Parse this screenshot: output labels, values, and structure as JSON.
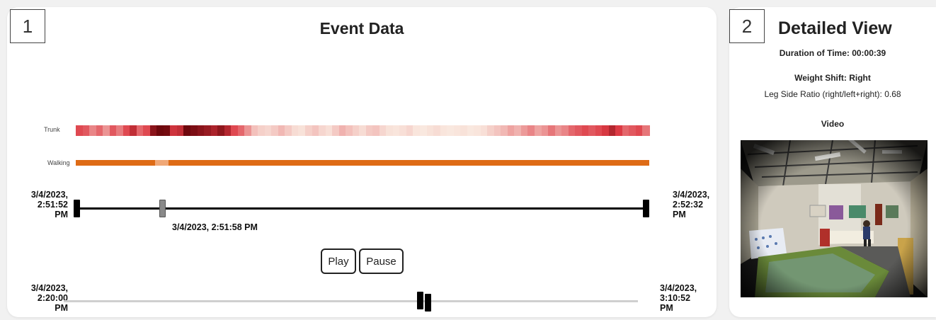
{
  "event_panel": {
    "number": "1",
    "title": "Event Data",
    "rows": [
      {
        "label": "Trunk"
      },
      {
        "label": "Walking"
      }
    ],
    "timeline": {
      "start_label_lines": [
        "3/4/2023,",
        "2:51:52",
        "PM"
      ],
      "end_label_lines": [
        "3/4/2023,",
        "2:52:32",
        "PM"
      ],
      "current_label": "3/4/2023, 2:51:58 PM",
      "position_fraction": 0.15
    },
    "controls": {
      "play_label": "Play",
      "pause_label": "Pause"
    },
    "overview": {
      "start_label_lines": [
        "3/4/2023,",
        "2:20:00",
        "PM"
      ],
      "end_label_lines": [
        "3/4/2023,",
        "3:10:52",
        "PM"
      ],
      "window_fraction": [
        0.62,
        0.634
      ]
    },
    "colors": {
      "walking": "#de6b16",
      "walking_highlight": "#f0a877",
      "track": "#000000",
      "overview_track": "#cfcfcf",
      "handle_gray": "#8a8a8a"
    },
    "trunk_intensity": [
      0.55,
      0.5,
      0.35,
      0.45,
      0.3,
      0.5,
      0.38,
      0.55,
      0.7,
      0.45,
      0.55,
      0.9,
      1.0,
      0.98,
      0.65,
      0.7,
      1.0,
      0.95,
      0.9,
      0.85,
      0.78,
      0.88,
      0.75,
      0.55,
      0.45,
      0.3,
      0.15,
      0.1,
      0.08,
      0.12,
      0.18,
      0.12,
      0.06,
      0.04,
      0.1,
      0.14,
      0.08,
      0.05,
      0.12,
      0.2,
      0.15,
      0.1,
      0.06,
      0.12,
      0.14,
      0.08,
      0.04,
      0.03,
      0.05,
      0.08,
      0.03,
      0.02,
      0.04,
      0.06,
      0.03,
      0.02,
      0.03,
      0.04,
      0.02,
      0.03,
      0.05,
      0.1,
      0.14,
      0.18,
      0.25,
      0.2,
      0.28,
      0.35,
      0.25,
      0.3,
      0.4,
      0.3,
      0.35,
      0.45,
      0.5,
      0.55,
      0.5,
      0.55,
      0.62,
      0.75,
      0.6,
      0.45,
      0.5,
      0.55,
      0.4
    ],
    "walking_highlight_fraction": [
      0.138,
      0.162
    ]
  },
  "detail_panel": {
    "number": "2",
    "title": "Detailed View",
    "duration": "Duration of Time: 00:00:39",
    "weight_shift": "Weight Shift: Right",
    "leg_ratio": "Leg Side Ratio (right/left+right): 0.68",
    "video_label": "Video"
  }
}
